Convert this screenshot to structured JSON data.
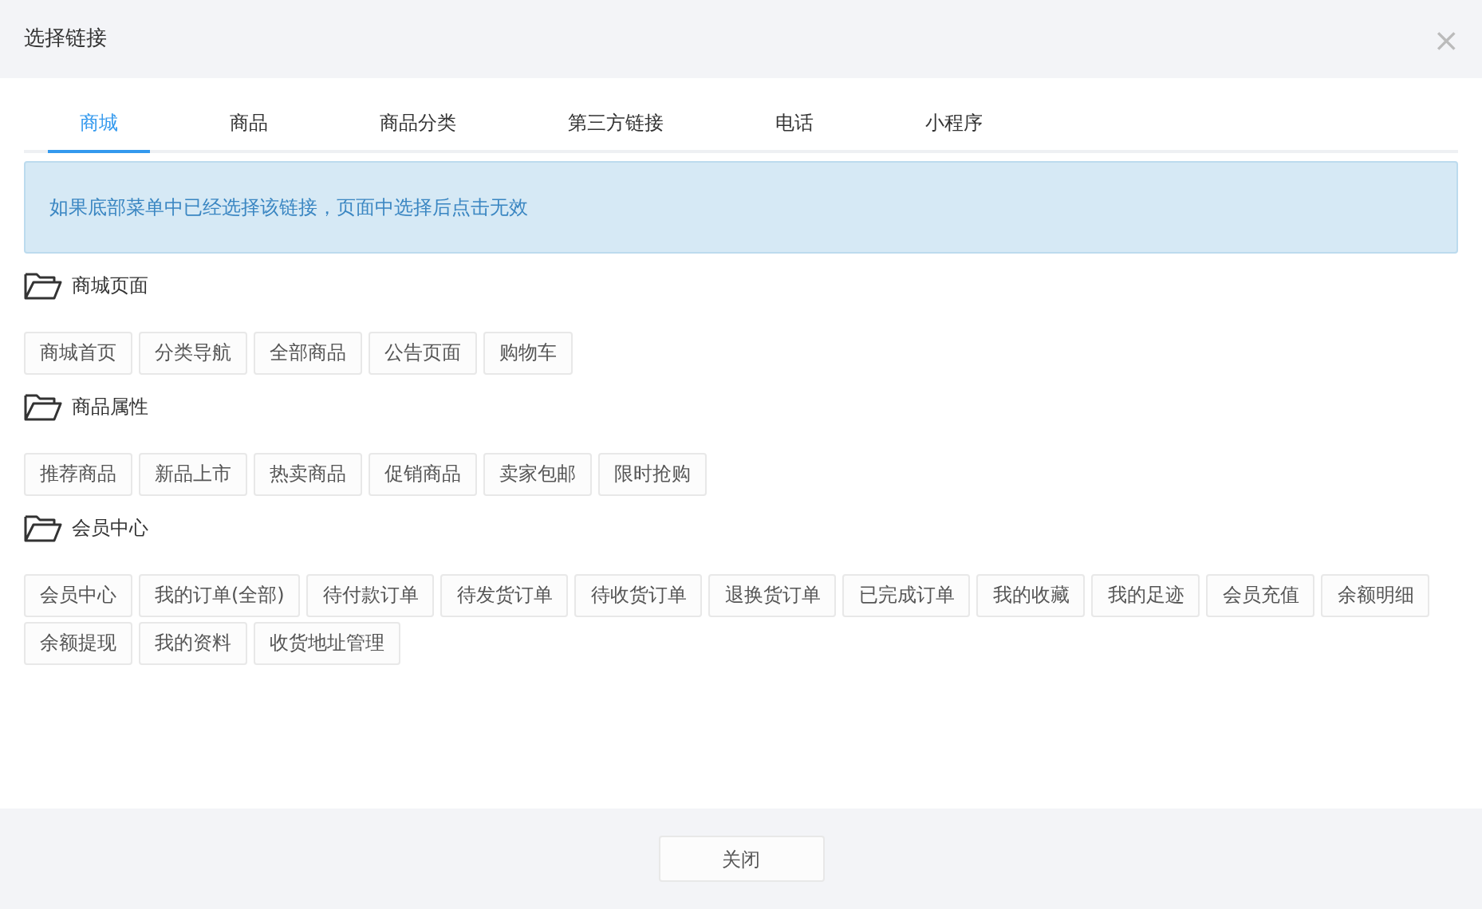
{
  "dialog": {
    "title": "选择链接",
    "close_icon": "×"
  },
  "tabs": [
    {
      "label": "商城",
      "selected": true
    },
    {
      "label": "商品",
      "selected": false
    },
    {
      "label": "商品分类",
      "selected": false
    },
    {
      "label": "第三方链接",
      "selected": false
    },
    {
      "label": "电话",
      "selected": false
    },
    {
      "label": "小程序",
      "selected": false
    }
  ],
  "notice": "如果底部菜单中已经选择该链接，页面中选择后点击无效",
  "groups": [
    {
      "title": "商城页面",
      "links": [
        "商城首页",
        "分类导航",
        "全部商品",
        "公告页面",
        "购物车"
      ]
    },
    {
      "title": "商品属性",
      "links": [
        "推荐商品",
        "新品上市",
        "热卖商品",
        "促销商品",
        "卖家包邮",
        "限时抢购"
      ]
    },
    {
      "title": "会员中心",
      "links": [
        "会员中心",
        "我的订单(全部)",
        "待付款订单",
        "待发货订单",
        "待收货订单",
        "退换货订单",
        "已完成订单",
        "我的收藏",
        "我的足迹",
        "会员充值",
        "余额明细",
        "余额提现",
        "我的资料",
        "收货地址管理"
      ]
    }
  ],
  "footer": {
    "close_button": "关闭"
  }
}
